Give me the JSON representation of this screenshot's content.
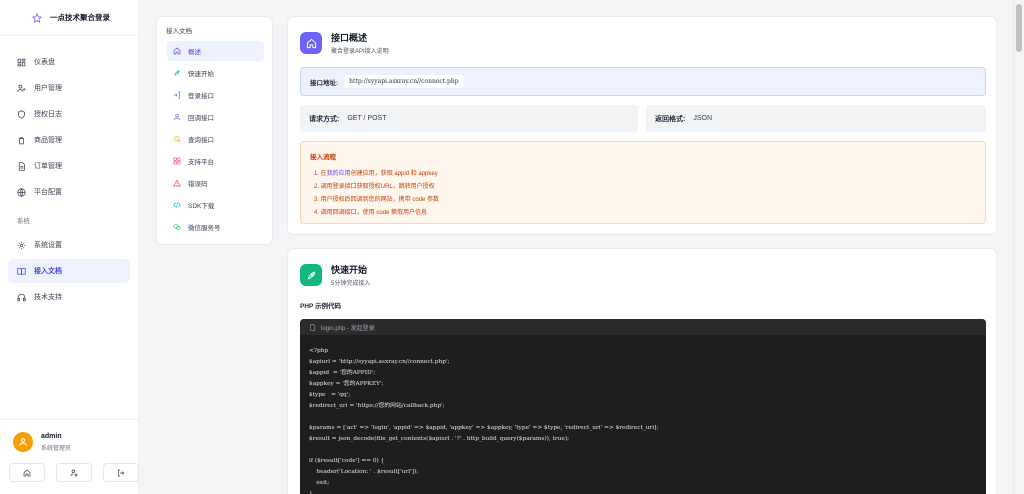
{
  "brand": {
    "title": "一点技术聚合登录",
    "icon": "star-icon"
  },
  "sidebar": {
    "items": [
      {
        "label": "仪表盘",
        "icon": "dashboard-icon"
      },
      {
        "label": "用户管理",
        "icon": "user-icon"
      },
      {
        "label": "授权日志",
        "icon": "shield-icon"
      },
      {
        "label": "商品管理",
        "icon": "package-icon"
      },
      {
        "label": "订单管理",
        "icon": "document-icon"
      },
      {
        "label": "平台配置",
        "icon": "globe-icon"
      }
    ],
    "section_label": "系统",
    "system_items": [
      {
        "label": "系统设置",
        "icon": "gear-icon"
      },
      {
        "label": "接入文档",
        "icon": "book-icon",
        "active": true
      },
      {
        "label": "技术支持",
        "icon": "headset-icon"
      }
    ]
  },
  "user": {
    "name": "admin",
    "role": "系统管理员"
  },
  "docnav": {
    "title": "接入文档",
    "items": [
      {
        "label": "概述",
        "icon": "home-icon",
        "active": true
      },
      {
        "label": "快速开始",
        "icon": "rocket-icon"
      },
      {
        "label": "登录接口",
        "icon": "login-icon"
      },
      {
        "label": "回调接口",
        "icon": "user-icon"
      },
      {
        "label": "查询接口",
        "icon": "search-icon"
      },
      {
        "label": "支持平台",
        "icon": "grid-icon"
      },
      {
        "label": "错误码",
        "icon": "warning-icon"
      },
      {
        "label": "SDK下载",
        "icon": "code-icon"
      },
      {
        "label": "微信服务号",
        "icon": "wechat-icon"
      }
    ]
  },
  "overview": {
    "title": "接口概述",
    "subtitle": "聚合登录API接入说明",
    "address_label": "接口地址:",
    "address_value": "http://syyapi.asxray.cn//connect.php",
    "method_label": "请求方式:",
    "method_value": "GET / POST",
    "format_label": "返回格式:",
    "format_value": "JSON",
    "flow_title": "接入流程",
    "flow_steps": {
      "s1_pre": "1. 在",
      "s1_link": "我的应用",
      "s1_post": "创建应用，获取 appid 和 appkey",
      "s2": "2. 调用登录接口获取授权URL，跳转用户授权",
      "s3": "3. 用户授权后回调到您的网站，携带 code 参数",
      "s4": "4. 调用回调接口，使用 code 换取用户信息"
    }
  },
  "quickstart": {
    "title": "快速开始",
    "subtitle": "5分钟完成接入",
    "php_label": "PHP 示例代码",
    "file_label": "login.php - 发起登录",
    "code_lines": [
      "<?php",
      "$apiurl = 'http://syyapi.asxray.cn//connect.php';",
      "$appid  = '您的APPID';",
      "$appkey = '您的APPKEY';",
      "$type   = 'qq';",
      "$redirect_uri = 'https://您的网站/callback.php';",
      "",
      "$params = ['act' => 'login', 'appid' => $appid, 'appkey' => $appkey, 'type' => $type, 'redirect_uri' => $redirect_uri];",
      "$result = json_decode(file_get_contents($apiurl . '?' . http_build_query($params)), true);",
      "",
      "if ($result['code'] == 0) {",
      "    header('Location: ' . $result['url']);",
      "    exit;",
      "}"
    ]
  },
  "colors": {
    "accent": "#4f46e5",
    "overview_icon": "#6d63f6",
    "quickstart_icon": "#10b981",
    "avatar": "#f59e0b"
  }
}
